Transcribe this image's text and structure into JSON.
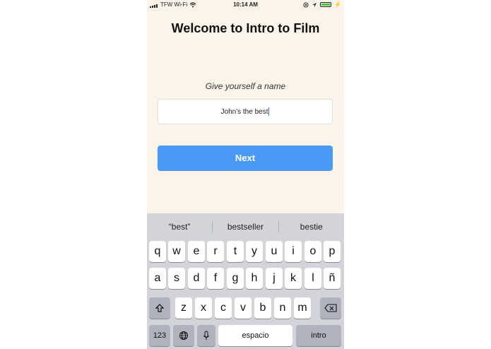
{
  "status_bar": {
    "carrier": "TFW Wi-Fi",
    "time": "10:14 AM",
    "battery_color": "#3ecb3e"
  },
  "screen": {
    "title": "Welcome to Intro to Film",
    "prompt": "Give yourself a name",
    "name_input_value": "John's the best",
    "next_label": "Next",
    "accent_color": "#4a9af5"
  },
  "keyboard": {
    "suggestions": [
      "“best”",
      "bestseller",
      "bestie"
    ],
    "row1": [
      "q",
      "w",
      "e",
      "r",
      "t",
      "y",
      "u",
      "i",
      "o",
      "p"
    ],
    "row2": [
      "a",
      "s",
      "d",
      "f",
      "g",
      "h",
      "j",
      "k",
      "l",
      "ñ"
    ],
    "row3": [
      "z",
      "x",
      "c",
      "v",
      "b",
      "n",
      "m"
    ],
    "shift_icon": "shift-icon",
    "delete_icon": "backspace-icon",
    "numbers_label": "123",
    "globe_icon": "globe-icon",
    "mic_icon": "microphone-icon",
    "space_label": "espacio",
    "return_label": "intro"
  }
}
